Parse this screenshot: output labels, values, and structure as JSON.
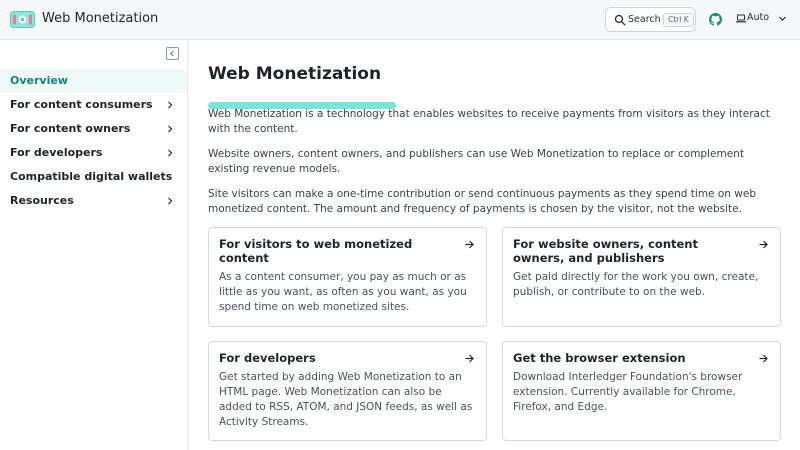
{
  "header": {
    "site_title": "Web Monetization",
    "search_label": "Search",
    "search_shortcut": "Ctrl K",
    "theme_label": "Auto"
  },
  "sidebar": {
    "items": [
      {
        "label": "Overview",
        "active": true,
        "expandable": false
      },
      {
        "label": "For content consumers",
        "active": false,
        "expandable": true
      },
      {
        "label": "For content owners",
        "active": false,
        "expandable": true
      },
      {
        "label": "For developers",
        "active": false,
        "expandable": true
      },
      {
        "label": "Compatible digital wallets",
        "active": false,
        "expandable": false
      },
      {
        "label": "Resources",
        "active": false,
        "expandable": true
      }
    ]
  },
  "main": {
    "title": "Web Monetization",
    "paragraphs": [
      "Web Monetization is a technology that enables websites to receive payments from visitors as they interact with the content.",
      "Website owners, content owners, and publishers can use Web Monetization to replace or complement existing revenue models.",
      "Site visitors can make a one-time contribution or send continuous payments as they spend time on web monetized content. The amount and frequency of payments is chosen by the visitor, not the website."
    ],
    "cards": [
      {
        "title": "For visitors to web monetized content",
        "description": "As a content consumer, you pay as much or as little as you want, as often as you want, as you spend time on web monetized sites."
      },
      {
        "title": "For website owners, content owners, and publishers",
        "description": "Get paid directly for the work you own, create, publish, or contribute to on the web."
      },
      {
        "title": "For developers",
        "description": "Get started by adding Web Monetization to an HTML page. Web Monetization can also be added to RSS, ATOM, and JSON feeds, as well as Activity Streams."
      },
      {
        "title": "Get the browser extension",
        "description": "Download Interledger Foundation's browser extension. Currently available for Chrome, Firefox, and Edge."
      }
    ]
  },
  "colors": {
    "accent": "#15807a",
    "highlight": "#7ee3d7",
    "active_bg": "#eef9f8"
  }
}
